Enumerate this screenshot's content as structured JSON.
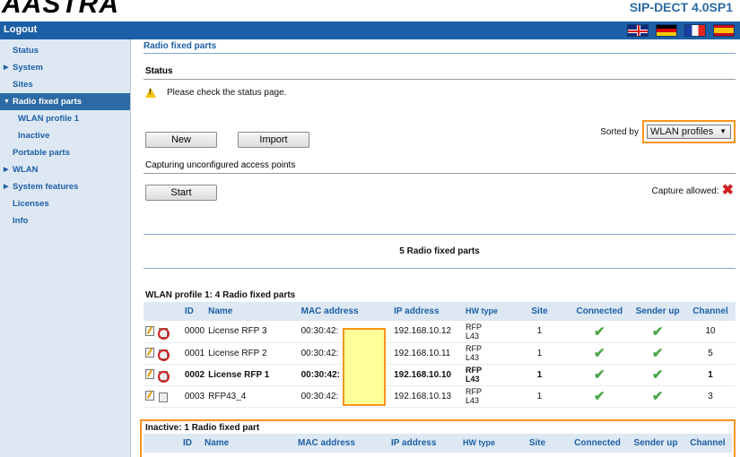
{
  "brand": {
    "logo_text": "AASTRA",
    "version": "SIP-DECT 4.0SP1"
  },
  "topbar": {
    "logout": "Logout"
  },
  "sidebar": {
    "items": [
      {
        "label": "Status",
        "arrow": ""
      },
      {
        "label": "System",
        "arrow": "▶"
      },
      {
        "label": "Sites",
        "arrow": ""
      },
      {
        "label": "Radio fixed parts",
        "arrow": "▼"
      },
      {
        "label": "WLAN profile 1",
        "arrow": ""
      },
      {
        "label": "Inactive",
        "arrow": ""
      },
      {
        "label": "Portable parts",
        "arrow": ""
      },
      {
        "label": "WLAN",
        "arrow": "▶"
      },
      {
        "label": "System features",
        "arrow": "▶"
      },
      {
        "label": "Licenses",
        "arrow": ""
      },
      {
        "label": "Info",
        "arrow": ""
      }
    ]
  },
  "main": {
    "title": "Radio fixed parts",
    "status_heading": "Status",
    "status_message": "Please check the status page.",
    "new_button": "New",
    "import_button": "Import",
    "sorted_by_label": "Sorted by",
    "sorted_by_value": "WLAN profiles",
    "capturing_heading": "Capturing unconfigured access points",
    "start_button": "Start",
    "capture_allowed_label": "Capture allowed:",
    "count_label": "5 Radio fixed parts"
  },
  "table_headers": {
    "id": "ID",
    "name": "Name",
    "mac": "MAC address",
    "ip": "IP address",
    "hw_type": "HW type",
    "site": "Site",
    "connected": "Connected",
    "sender_up": "Sender up",
    "channel": "Channel"
  },
  "wlan_table": {
    "title": "WLAN profile 1: 4 Radio fixed parts",
    "rows": [
      {
        "id": "0000",
        "name": "License RFP 3",
        "mac": "00:30:42:",
        "ip": "192.168.10.12",
        "hw1": "RFP",
        "hw2": "L43",
        "site": "1",
        "channel": "10"
      },
      {
        "id": "0001",
        "name": "License RFP 2",
        "mac": "00:30:42:",
        "ip": "192.168.10.11",
        "hw1": "RFP",
        "hw2": "L43",
        "site": "1",
        "channel": "5"
      },
      {
        "id": "0002",
        "name": "License RFP 1",
        "mac": "00:30:42:",
        "ip": "192.168.10.10",
        "hw1": "RFP",
        "hw2": "L43",
        "site": "1",
        "channel": "1"
      },
      {
        "id": "0003",
        "name": "RFP43_4",
        "mac": "00:30:42:",
        "ip": "192.168.10.13",
        "hw1": "RFP",
        "hw2": "L43",
        "site": "1",
        "channel": "3"
      }
    ]
  },
  "inactive_table": {
    "title": "Inactive: 1 Radio fixed part"
  },
  "icons": {
    "warning": "warning-icon",
    "check": "check-icon",
    "x": "x-icon",
    "edit": "edit-icon",
    "delete": "delete-icon"
  },
  "colors": {
    "accent": "#1d5fa6",
    "highlight": "#f7941d",
    "mask": "#ffff99"
  }
}
